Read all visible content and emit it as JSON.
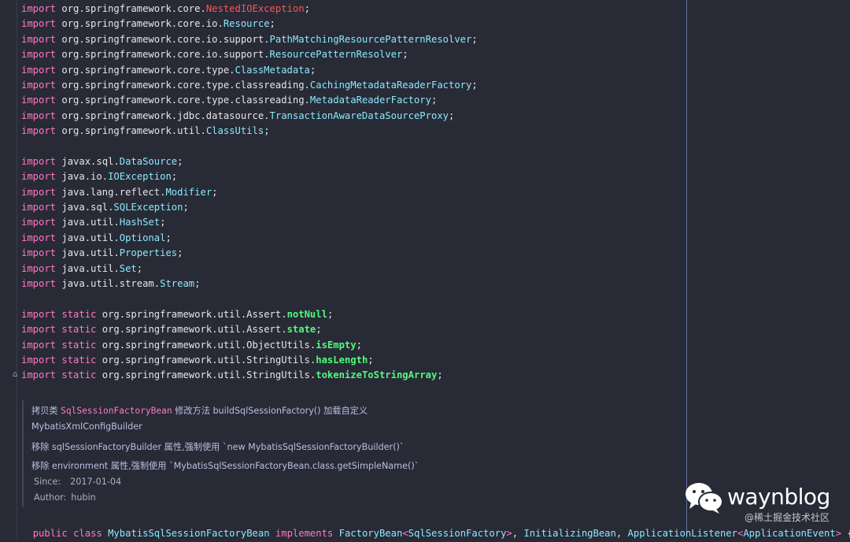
{
  "imports": [
    {
      "pre": "org.springframework.core.",
      "name": "NestedIOException",
      "style": "red",
      "post": ";"
    },
    {
      "pre": "org.springframework.core.io.",
      "name": "Resource",
      "style": "cls",
      "post": ";"
    },
    {
      "pre": "org.springframework.core.io.support.",
      "name": "PathMatchingResourcePatternResolver",
      "style": "cls",
      "post": ";"
    },
    {
      "pre": "org.springframework.core.io.support.",
      "name": "ResourcePatternResolver",
      "style": "cls",
      "post": ";"
    },
    {
      "pre": "org.springframework.core.type.",
      "name": "ClassMetadata",
      "style": "cls",
      "post": ";"
    },
    {
      "pre": "org.springframework.core.type.classreading.",
      "name": "CachingMetadataReaderFactory",
      "style": "cls",
      "post": ";"
    },
    {
      "pre": "org.springframework.core.type.classreading.",
      "name": "MetadataReaderFactory",
      "style": "cls",
      "post": ";"
    },
    {
      "pre": "org.springframework.jdbc.datasource.",
      "name": "TransactionAwareDataSourceProxy",
      "style": "cls",
      "post": ";"
    },
    {
      "pre": "org.springframework.util.",
      "name": "ClassUtils",
      "style": "cls",
      "post": ";"
    },
    null,
    {
      "pre": "javax.sql.",
      "name": "DataSource",
      "style": "cls",
      "post": ";"
    },
    {
      "pre": "java.io.",
      "name": "IOException",
      "style": "cls",
      "post": ";"
    },
    {
      "pre": "java.lang.reflect.",
      "name": "Modifier",
      "style": "cls",
      "post": ";"
    },
    {
      "pre": "java.sql.",
      "name": "SQLException",
      "style": "cls",
      "post": ";"
    },
    {
      "pre": "java.util.",
      "name": "HashSet",
      "style": "cls",
      "post": ";"
    },
    {
      "pre": "java.util.",
      "name": "Optional",
      "style": "cls",
      "post": ";"
    },
    {
      "pre": "java.util.",
      "name": "Properties",
      "style": "cls",
      "post": ";"
    },
    {
      "pre": "java.util.",
      "name": "Set",
      "style": "cls",
      "post": ";"
    },
    {
      "pre": "java.util.stream.",
      "name": "Stream",
      "style": "cls",
      "post": ";"
    },
    null,
    {
      "kw2": "static",
      "pre": "org.springframework.util.Assert.",
      "name": "notNull",
      "style": "fn",
      "post": ";"
    },
    {
      "kw2": "static",
      "pre": "org.springframework.util.Assert.",
      "name": "state",
      "style": "fn",
      "post": ";"
    },
    {
      "kw2": "static",
      "pre": "org.springframework.util.ObjectUtils.",
      "name": "isEmpty",
      "style": "fn",
      "post": ";"
    },
    {
      "kw2": "static",
      "pre": "org.springframework.util.StringUtils.",
      "name": "hasLength",
      "style": "fn",
      "post": ";"
    },
    {
      "kw2": "static",
      "pre": "org.springframework.util.StringUtils.",
      "name": "tokenizeToStringArray",
      "style": "fn",
      "post": ";"
    }
  ],
  "import_keyword": "import",
  "doc": {
    "line1_a": "拷贝类 ",
    "line1_code": "SqlSessionFactoryBean",
    "line1_b": " 修改方法 buildSqlSessionFactory() 加载自定义",
    "line2": "MybatisXmlConfigBuilder",
    "line3": "移除 sqlSessionFactoryBuilder 属性,强制使用 `new MybatisSqlSessionFactoryBuilder()`",
    "line4": "移除 environment 属性,强制使用 `MybatisSqlSessionFactoryBean.class.getSimpleName()`",
    "since_label": "Since:",
    "since_value": "2017-01-04",
    "author_label": "Author:",
    "author_value": "hubin"
  },
  "declaration": {
    "kw1": "public",
    "kw2": "class",
    "class_name": "MybatisSqlSessionFactoryBean",
    "kw3": "implements",
    "i1": "FactoryBean",
    "i1_gen": "SqlSessionFactory",
    "i2": "InitializingBean",
    "i3": "ApplicationListener",
    "i3_gen": "ApplicationEvent",
    "tail": " {"
  },
  "watermark": {
    "name": "waynblog",
    "sub": "@稀土掘金技术社区"
  },
  "colors": {
    "background": "#282a36",
    "keyword": "#ff79c6",
    "class": "#8be9fd",
    "function": "#50fa7b",
    "error": "#ff5555"
  }
}
